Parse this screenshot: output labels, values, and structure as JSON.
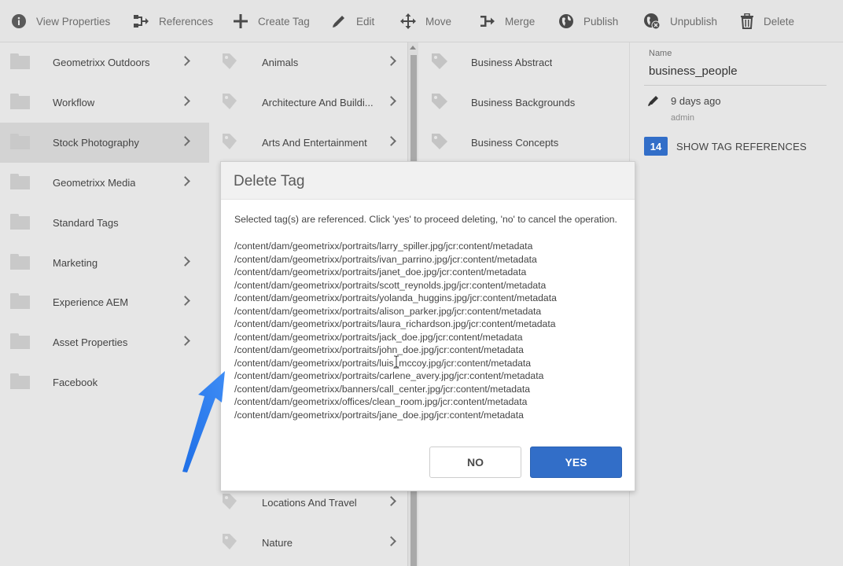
{
  "toolbar": {
    "view_properties": "View Properties",
    "references": "References",
    "create_tag": "Create Tag",
    "edit": "Edit",
    "move": "Move",
    "merge": "Merge",
    "publish": "Publish",
    "unpublish": "Unpublish",
    "delete": "Delete"
  },
  "column1": {
    "items": [
      {
        "label": "Geometrixx Outdoors",
        "has_children": true
      },
      {
        "label": "Workflow",
        "has_children": true
      },
      {
        "label": "Stock Photography",
        "has_children": true,
        "selected": true
      },
      {
        "label": "Geometrixx Media",
        "has_children": true
      },
      {
        "label": "Standard Tags",
        "has_children": false
      },
      {
        "label": "Marketing",
        "has_children": true
      },
      {
        "label": "Experience AEM",
        "has_children": true
      },
      {
        "label": "Asset Properties",
        "has_children": true
      },
      {
        "label": "Facebook",
        "has_children": false
      }
    ]
  },
  "column2": {
    "items": [
      {
        "label": "Animals"
      },
      {
        "label": "Architecture And Buildi..."
      },
      {
        "label": "Arts And Entertainment"
      },
      {
        "label": "Locations And Travel"
      },
      {
        "label": "Nature"
      }
    ]
  },
  "column3": {
    "items": [
      {
        "label": "Business Abstract"
      },
      {
        "label": "Business Backgrounds"
      },
      {
        "label": "Business Concepts"
      }
    ]
  },
  "meta": {
    "name_label": "Name",
    "name_value": "business_people",
    "modified": "9 days ago",
    "modified_by": "admin",
    "reference_count": "14",
    "show_references": "SHOW TAG REFERENCES"
  },
  "dialog": {
    "title": "Delete Tag",
    "message": "Selected tag(s) are referenced. Click 'yes' to proceed deleting, 'no' to cancel the operation.",
    "paths": [
      "/content/dam/geometrixx/portraits/larry_spiller.jpg/jcr:content/metadata",
      "/content/dam/geometrixx/portraits/ivan_parrino.jpg/jcr:content/metadata",
      "/content/dam/geometrixx/portraits/janet_doe.jpg/jcr:content/metadata",
      "/content/dam/geometrixx/portraits/scott_reynolds.jpg/jcr:content/metadata",
      "/content/dam/geometrixx/portraits/yolanda_huggins.jpg/jcr:content/metadata",
      "/content/dam/geometrixx/portraits/alison_parker.jpg/jcr:content/metadata",
      "/content/dam/geometrixx/portraits/laura_richardson.jpg/jcr:content/metadata",
      "/content/dam/geometrixx/portraits/jack_doe.jpg/jcr:content/metadata",
      "/content/dam/geometrixx/portraits/john_doe.jpg/jcr:content/metadata",
      "/content/dam/geometrixx/portraits/luis_mccoy.jpg/jcr:content/metadata",
      "/content/dam/geometrixx/portraits/carlene_avery.jpg/jcr:content/metadata",
      "/content/dam/geometrixx/banners/call_center.jpg/jcr:content/metadata",
      "/content/dam/geometrixx/offices/clean_room.jpg/jcr:content/metadata",
      "/content/dam/geometrixx/portraits/jane_doe.jpg/jcr:content/metadata"
    ],
    "no_label": "NO",
    "yes_label": "YES"
  },
  "colors": {
    "accent": "#326ec8",
    "annotation_arrow": "#2f7ff0"
  }
}
